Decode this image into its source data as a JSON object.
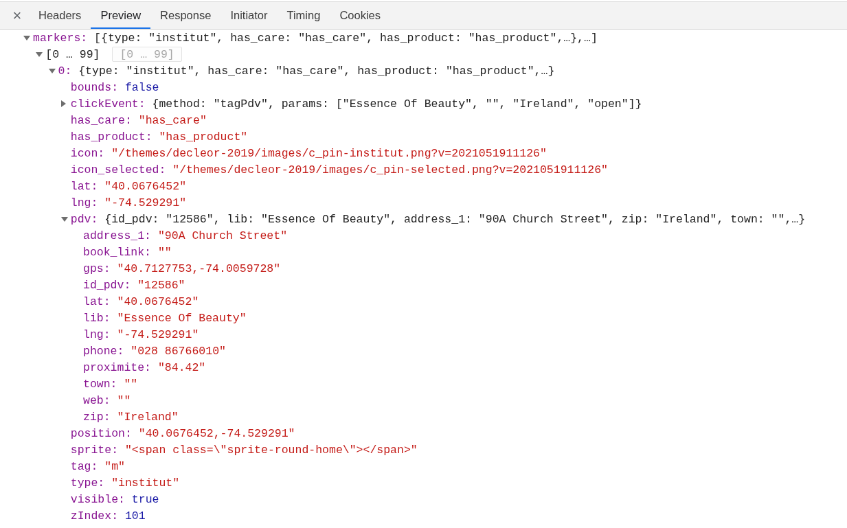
{
  "close_button": "×",
  "tabs": [
    {
      "label": "Headers",
      "selected": false
    },
    {
      "label": "Preview",
      "selected": true
    },
    {
      "label": "Response",
      "selected": false
    },
    {
      "label": "Initiator",
      "selected": false
    },
    {
      "label": "Timing",
      "selected": false
    },
    {
      "label": "Cookies",
      "selected": false
    }
  ],
  "tree": [
    {
      "kind": "object",
      "key": "markers:",
      "preview": "[{type: \"institut\", has_care: \"has_care\", has_product: \"has_product\",…},…]",
      "expanded": true,
      "children": [
        {
          "kind": "range",
          "label": "[0 … 99]",
          "expanded": true,
          "children": [
            {
              "kind": "object",
              "key": "0:",
              "preview": "{type: \"institut\", has_care: \"has_care\", has_product: \"has_product\",…}",
              "expanded": true,
              "children": [
                {
                  "kind": "boolean",
                  "key": "bounds:",
                  "value": "false"
                },
                {
                  "kind": "object",
                  "key": "clickEvent:",
                  "preview": "{method: \"tagPdv\", params: [\"Essence Of Beauty\", \"\", \"Ireland\", \"open\"]}",
                  "expanded": false
                },
                {
                  "kind": "string",
                  "key": "has_care:",
                  "value": "\"has_care\""
                },
                {
                  "kind": "string",
                  "key": "has_product:",
                  "value": "\"has_product\""
                },
                {
                  "kind": "string",
                  "key": "icon:",
                  "value": "\"/themes/decleor-2019/images/c_pin-institut.png?v=2021051911126\""
                },
                {
                  "kind": "string",
                  "key": "icon_selected:",
                  "value": "\"/themes/decleor-2019/images/c_pin-selected.png?v=2021051911126\""
                },
                {
                  "kind": "string",
                  "key": "lat:",
                  "value": "\"40.0676452\""
                },
                {
                  "kind": "string",
                  "key": "lng:",
                  "value": "\"-74.529291\""
                },
                {
                  "kind": "object",
                  "key": "pdv:",
                  "preview": "{id_pdv: \"12586\", lib: \"Essence Of Beauty\", address_1: \"90A Church Street\", zip: \"Ireland\", town: \"\",…}",
                  "expanded": true,
                  "children": [
                    {
                      "kind": "string",
                      "key": "address_1:",
                      "value": "\"90A Church Street\""
                    },
                    {
                      "kind": "string",
                      "key": "book_link:",
                      "value": "\"\""
                    },
                    {
                      "kind": "string",
                      "key": "gps:",
                      "value": "\"40.7127753,-74.0059728\""
                    },
                    {
                      "kind": "string",
                      "key": "id_pdv:",
                      "value": "\"12586\""
                    },
                    {
                      "kind": "string",
                      "key": "lat:",
                      "value": "\"40.0676452\""
                    },
                    {
                      "kind": "string",
                      "key": "lib:",
                      "value": "\"Essence Of Beauty\""
                    },
                    {
                      "kind": "string",
                      "key": "lng:",
                      "value": "\"-74.529291\""
                    },
                    {
                      "kind": "string",
                      "key": "phone:",
                      "value": "\"028 86766010\""
                    },
                    {
                      "kind": "string",
                      "key": "proximite:",
                      "value": "\"84.42\""
                    },
                    {
                      "kind": "string",
                      "key": "town:",
                      "value": "\"\""
                    },
                    {
                      "kind": "string",
                      "key": "web:",
                      "value": "\"\""
                    },
                    {
                      "kind": "string",
                      "key": "zip:",
                      "value": "\"Ireland\""
                    }
                  ]
                },
                {
                  "kind": "string",
                  "key": "position:",
                  "value": "\"40.0676452,-74.529291\""
                },
                {
                  "kind": "string",
                  "key": "sprite:",
                  "value": "\"<span class=\\\"sprite-round-home\\\"></span>\""
                },
                {
                  "kind": "string",
                  "key": "tag:",
                  "value": "\"m\""
                },
                {
                  "kind": "string",
                  "key": "type:",
                  "value": "\"institut\""
                },
                {
                  "kind": "boolean",
                  "key": "visible:",
                  "value": "true"
                },
                {
                  "kind": "number",
                  "key": "zIndex:",
                  "value": "101"
                }
              ]
            }
          ]
        }
      ]
    }
  ],
  "tooltip": {
    "text": "[0 … 99]"
  }
}
